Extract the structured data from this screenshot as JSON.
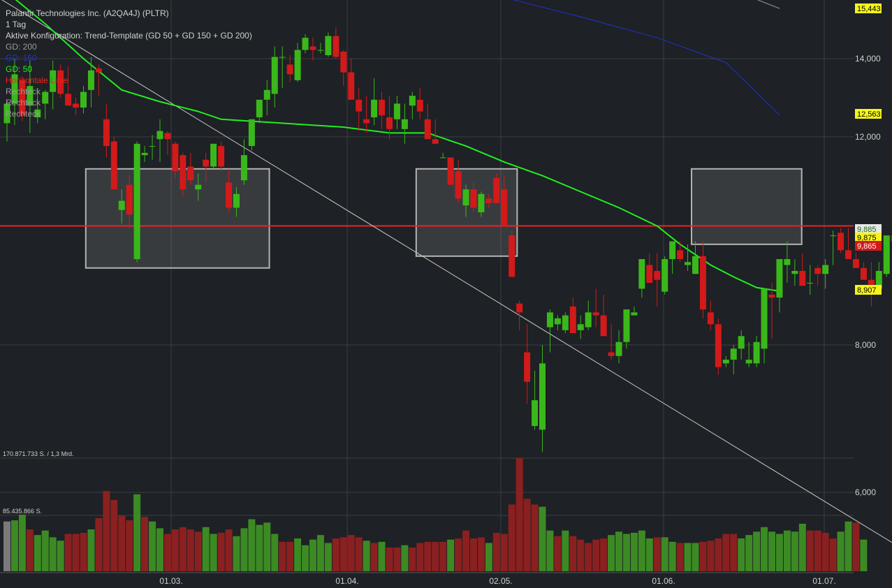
{
  "header": {
    "title": "Palantir Technologies Inc. (A2QA4J) (PLTR)",
    "interval": "1 Tag",
    "config": "Aktive Konfiguration: Trend-Template (GD 50 + GD 150 + GD 200)"
  },
  "legend": [
    {
      "label": "GD: 200",
      "color": "#9a9a9a"
    },
    {
      "label": "GD: 150",
      "color": "#2233cc"
    },
    {
      "label": "GD: 50",
      "color": "#22ee22"
    },
    {
      "label": "Horizontale Linie",
      "color": "#ee2222"
    },
    {
      "label": "Rechteck",
      "color": "#9a9a9a"
    },
    {
      "label": "Rechteck",
      "color": "#9a9a9a"
    },
    {
      "label": "Rechteck",
      "color": "#9a9a9a"
    }
  ],
  "volume_labels": {
    "max": "170.871.733 S. / 1,3 Mrd.",
    "mid": "85.435.866 S."
  },
  "colors": {
    "background": "#1e2125",
    "up": "#3ab81a",
    "down": "#d21a1a",
    "volume_up": "#3c8a24",
    "volume_down": "#8a2020",
    "grid": "#3a3e44",
    "sma50": "#22ee22",
    "sma150": "#2233cc",
    "sma200": "#9a9a9a",
    "hline": "#ee2222"
  },
  "chart_data": {
    "type": "candlestick",
    "y_ticks": [
      "6,000",
      "8,000",
      "12,000",
      "14,000"
    ],
    "x_ticks": [
      "01.03.",
      "01.04.",
      "02.05.",
      "01.06.",
      "01.07."
    ],
    "ylim": [
      5.4,
      15.7
    ],
    "price_labels": [
      {
        "text": "15,443",
        "value": 15.443,
        "style": "yellow"
      },
      {
        "text": "12,563",
        "value": 12.563,
        "style": "yellow"
      },
      {
        "text": "9,885",
        "value": 9.885,
        "style": "green"
      },
      {
        "text": "9,875",
        "value": 9.875,
        "style": "yellow"
      },
      {
        "text": "9,865",
        "value": 9.865,
        "style": "red"
      },
      {
        "text": "8,907",
        "value": 8.907,
        "style": "yellow"
      }
    ],
    "horizontal_line": 10.05,
    "series": [
      {
        "name": "GD 50",
        "values": [
          [
            0,
            15.9
          ],
          [
            5,
            15.0
          ],
          [
            10,
            14.0
          ],
          [
            15,
            13.2
          ],
          [
            20,
            12.9
          ],
          [
            25,
            12.65
          ],
          [
            28,
            12.45
          ],
          [
            32,
            12.4
          ],
          [
            36,
            12.35
          ],
          [
            40,
            12.3
          ],
          [
            44,
            12.25
          ],
          [
            50,
            12.1
          ],
          [
            55,
            12.1
          ],
          [
            60,
            11.8
          ],
          [
            65,
            11.45
          ],
          [
            70,
            11.15
          ],
          [
            75,
            10.8
          ],
          [
            80,
            10.45
          ],
          [
            85,
            10.05
          ],
          [
            88,
            9.7
          ],
          [
            92,
            9.35
          ],
          [
            95,
            9.15
          ],
          [
            98,
            8.97
          ],
          [
            101,
            8.91
          ]
        ]
      },
      {
        "name": "GD 150",
        "values": [
          [
            66,
            15.7
          ],
          [
            75,
            15.2
          ],
          [
            85,
            14.6
          ],
          [
            94,
            13.9
          ],
          [
            101,
            12.56
          ]
        ]
      },
      {
        "name": "GD 200",
        "values": [
          [
            98,
            15.7
          ],
          [
            101,
            15.44
          ]
        ]
      }
    ],
    "trendline": [
      [
        0,
        15.6
      ],
      [
        101,
        6.25
      ]
    ],
    "rectangles": [
      {
        "x0": 10.3,
        "x1": 34.3,
        "y0": 9.3,
        "y1": 11.3
      },
      {
        "x0": 53.5,
        "x1": 66.7,
        "y0": 9.5,
        "y1": 11.3
      },
      {
        "x0": 89.5,
        "x1": 103.9,
        "y0": 9.7,
        "y1": 11.3
      }
    ],
    "candles": [
      [
        12.35,
        12.95,
        11.9,
        12.85
      ],
      [
        12.85,
        14.0,
        12.3,
        13.6
      ],
      [
        13.45,
        13.55,
        12.4,
        12.55
      ],
      [
        12.8,
        13.95,
        12.1,
        13.3
      ],
      [
        12.5,
        13.25,
        12.35,
        12.7
      ],
      [
        12.85,
        13.2,
        12.45,
        13.15
      ],
      [
        13.15,
        13.95,
        12.7,
        13.7
      ],
      [
        13.7,
        13.85,
        13.0,
        13.1
      ],
      [
        13.1,
        13.8,
        12.95,
        12.8
      ],
      [
        12.85,
        13.0,
        12.55,
        12.75
      ],
      [
        12.75,
        13.3,
        12.6,
        13.15
      ],
      [
        13.2,
        14.05,
        12.75,
        13.7
      ],
      [
        13.75,
        13.85,
        13.05,
        13.65
      ],
      [
        12.45,
        12.85,
        11.55,
        11.8
      ],
      [
        11.9,
        12.0,
        10.85,
        10.85
      ],
      [
        10.4,
        10.85,
        10.1,
        10.6
      ],
      [
        10.95,
        11.15,
        10.0,
        10.3
      ],
      [
        9.45,
        11.9,
        9.4,
        11.85
      ],
      [
        11.6,
        11.8,
        11.45,
        11.65
      ],
      [
        11.8,
        12.05,
        11.5,
        11.8
      ],
      [
        11.95,
        12.45,
        11.45,
        12.15
      ],
      [
        12.1,
        12.15,
        11.6,
        11.95
      ],
      [
        11.85,
        11.9,
        11.1,
        11.25
      ],
      [
        11.6,
        11.65,
        10.7,
        10.85
      ],
      [
        11.35,
        11.65,
        10.95,
        11.05
      ],
      [
        10.85,
        11.2,
        10.6,
        10.95
      ],
      [
        11.5,
        11.65,
        11.0,
        11.35
      ],
      [
        11.35,
        11.8,
        11.3,
        11.85
      ],
      [
        11.8,
        11.9,
        11.25,
        11.35
      ],
      [
        11.0,
        11.3,
        10.35,
        10.45
      ],
      [
        10.45,
        10.9,
        10.25,
        10.75
      ],
      [
        11.05,
        11.95,
        10.95,
        11.6
      ],
      [
        11.8,
        12.4,
        11.7,
        12.45
      ],
      [
        12.5,
        12.85,
        12.35,
        12.95
      ],
      [
        12.95,
        13.45,
        12.55,
        13.2
      ],
      [
        13.1,
        14.35,
        12.75,
        14.05
      ],
      [
        14.05,
        14.35,
        13.25,
        14.05
      ],
      [
        13.85,
        14.1,
        13.4,
        13.6
      ],
      [
        13.45,
        14.45,
        13.4,
        14.25
      ],
      [
        14.25,
        14.7,
        14.15,
        14.6
      ],
      [
        14.35,
        14.6,
        13.95,
        14.25
      ],
      [
        14.25,
        14.45,
        14.15,
        14.25
      ],
      [
        14.1,
        14.75,
        14.05,
        14.65
      ],
      [
        14.65,
        14.9,
        14.0,
        14.05
      ],
      [
        14.2,
        14.25,
        13.3,
        13.65
      ],
      [
        13.65,
        14.0,
        12.95,
        12.95
      ],
      [
        12.95,
        13.25,
        12.15,
        12.65
      ],
      [
        12.45,
        13.05,
        12.1,
        12.35
      ],
      [
        12.5,
        13.5,
        12.3,
        12.95
      ],
      [
        12.95,
        13.15,
        12.2,
        12.55
      ],
      [
        12.5,
        13.05,
        11.95,
        12.2
      ],
      [
        12.45,
        13.05,
        12.2,
        12.85
      ],
      [
        12.2,
        12.85,
        11.85,
        12.45
      ],
      [
        12.8,
        13.15,
        12.45,
        13.05
      ],
      [
        12.95,
        13.25,
        12.45,
        12.65
      ],
      [
        12.45,
        12.85,
        12.05,
        11.95
      ],
      [
        11.95,
        12.45,
        11.85,
        11.85
      ],
      [
        11.55,
        11.65,
        11.55,
        11.55
      ],
      [
        11.55,
        11.55,
        11.1,
        10.95
      ],
      [
        11.25,
        11.5,
        10.55,
        10.65
      ],
      [
        10.5,
        10.95,
        10.25,
        10.85
      ],
      [
        10.85,
        11.0,
        10.35,
        10.45
      ],
      [
        10.35,
        10.8,
        10.25,
        10.75
      ],
      [
        10.65,
        10.75,
        10.45,
        10.55
      ],
      [
        11.1,
        11.2,
        10.55,
        10.55
      ],
      [
        10.85,
        11.15,
        10.35,
        10.05
      ],
      [
        9.85,
        9.95,
        9.15,
        9.15
      ],
      [
        8.7,
        8.75,
        8.25,
        8.55
      ],
      [
        7.9,
        8.35,
        7.2,
        7.5
      ],
      [
        6.9,
        7.65,
        6.85,
        7.25
      ],
      [
        6.85,
        8.0,
        6.55,
        7.75
      ],
      [
        8.3,
        8.6,
        7.9,
        8.55
      ],
      [
        8.35,
        8.5,
        8.25,
        8.45
      ],
      [
        8.25,
        8.55,
        8.2,
        8.5
      ],
      [
        8.65,
        8.8,
        8.25,
        8.2
      ],
      [
        8.25,
        8.5,
        8.1,
        8.35
      ],
      [
        8.3,
        8.75,
        8.25,
        8.55
      ],
      [
        8.55,
        8.95,
        8.3,
        8.5
      ],
      [
        8.5,
        8.85,
        8.15,
        8.15
      ],
      [
        7.9,
        8.35,
        7.8,
        7.85
      ],
      [
        7.85,
        8.25,
        7.75,
        8.05
      ],
      [
        8.05,
        8.6,
        7.95,
        8.6
      ],
      [
        8.5,
        8.65,
        8.5,
        8.55
      ],
      [
        8.95,
        9.35,
        8.8,
        9.45
      ],
      [
        9.35,
        9.55,
        9.1,
        9.05
      ],
      [
        9.25,
        9.55,
        8.65,
        9.1
      ],
      [
        8.9,
        9.5,
        8.85,
        9.45
      ],
      [
        9.45,
        9.55,
        9.2,
        9.75
      ],
      [
        9.6,
        9.75,
        9.4,
        9.45
      ],
      [
        9.35,
        9.7,
        9.25,
        9.4
      ],
      [
        9.2,
        9.75,
        9.2,
        9.5
      ],
      [
        9.5,
        9.75,
        8.45,
        8.6
      ],
      [
        8.55,
        8.75,
        8.25,
        8.35
      ],
      [
        8.35,
        8.45,
        7.6,
        7.7
      ],
      [
        7.75,
        7.85,
        7.7,
        7.8
      ],
      [
        7.8,
        8.0,
        7.6,
        7.95
      ],
      [
        7.95,
        8.25,
        7.8,
        8.15
      ],
      [
        7.75,
        8.05,
        7.7,
        7.8
      ],
      [
        7.75,
        8.15,
        7.7,
        8.05
      ],
      [
        7.95,
        8.95,
        7.75,
        8.95
      ],
      [
        8.85,
        9.05,
        8.1,
        8.8
      ],
      [
        8.8,
        9.1,
        8.55,
        9.45
      ],
      [
        9.35,
        9.75,
        9.05,
        9.45
      ],
      [
        9.2,
        9.45,
        9.0,
        9.25
      ],
      [
        9.25,
        9.55,
        9.15,
        9.0
      ],
      [
        9.05,
        9.35,
        8.85,
        9.05
      ],
      [
        9.3,
        9.35,
        9.0,
        9.2
      ],
      [
        9.2,
        9.45,
        8.95,
        9.35
      ],
      [
        9.85,
        9.95,
        9.35,
        9.85
      ],
      [
        9.9,
        10.0,
        9.55,
        9.6
      ],
      [
        9.6,
        10.0,
        9.45,
        9.45
      ],
      [
        9.45,
        9.55,
        9.35,
        9.3
      ],
      [
        9.3,
        9.4,
        9.2,
        9.1
      ],
      [
        9.1,
        9.4,
        8.65,
        9.0
      ],
      [
        8.95,
        9.4,
        8.85,
        9.25
      ],
      [
        9.2,
        9.8,
        9.15,
        9.85
      ],
      [
        9.85,
        10.15,
        9.75,
        9.75
      ],
      [
        9.75,
        10.0,
        9.7,
        9.95
      ],
      [
        9.95,
        10.1,
        9.8,
        9.85
      ]
    ],
    "volume": [
      [
        0.44,
        "flat"
      ],
      [
        0.45,
        "up"
      ],
      [
        0.5,
        "up"
      ],
      [
        0.37,
        "down"
      ],
      [
        0.32,
        "up"
      ],
      [
        0.36,
        "up"
      ],
      [
        0.3,
        "up"
      ],
      [
        0.27,
        "up"
      ],
      [
        0.33,
        "down"
      ],
      [
        0.33,
        "down"
      ],
      [
        0.34,
        "down"
      ],
      [
        0.37,
        "up"
      ],
      [
        0.47,
        "down"
      ],
      [
        0.71,
        "down"
      ],
      [
        0.63,
        "down"
      ],
      [
        0.49,
        "down"
      ],
      [
        0.45,
        "down"
      ],
      [
        0.68,
        "up"
      ],
      [
        0.48,
        "down"
      ],
      [
        0.44,
        "up"
      ],
      [
        0.38,
        "up"
      ],
      [
        0.33,
        "down"
      ],
      [
        0.37,
        "down"
      ],
      [
        0.39,
        "down"
      ],
      [
        0.37,
        "down"
      ],
      [
        0.35,
        "down"
      ],
      [
        0.39,
        "up"
      ],
      [
        0.33,
        "up"
      ],
      [
        0.34,
        "down"
      ],
      [
        0.37,
        "down"
      ],
      [
        0.31,
        "up"
      ],
      [
        0.38,
        "up"
      ],
      [
        0.46,
        "up"
      ],
      [
        0.41,
        "up"
      ],
      [
        0.43,
        "up"
      ],
      [
        0.33,
        "up"
      ],
      [
        0.26,
        "down"
      ],
      [
        0.26,
        "down"
      ],
      [
        0.29,
        "up"
      ],
      [
        0.23,
        "up"
      ],
      [
        0.28,
        "up"
      ],
      [
        0.32,
        "up"
      ],
      [
        0.25,
        "up"
      ],
      [
        0.29,
        "down"
      ],
      [
        0.3,
        "down"
      ],
      [
        0.32,
        "down"
      ],
      [
        0.3,
        "down"
      ],
      [
        0.27,
        "up"
      ],
      [
        0.25,
        "down"
      ],
      [
        0.26,
        "up"
      ],
      [
        0.21,
        "down"
      ],
      [
        0.21,
        "down"
      ],
      [
        0.23,
        "up"
      ],
      [
        0.21,
        "down"
      ],
      [
        0.25,
        "down"
      ],
      [
        0.26,
        "down"
      ],
      [
        0.26,
        "down"
      ],
      [
        0.26,
        "down"
      ],
      [
        0.28,
        "up"
      ],
      [
        0.29,
        "down"
      ],
      [
        0.36,
        "down"
      ],
      [
        0.29,
        "down"
      ],
      [
        0.3,
        "down"
      ],
      [
        0.25,
        "up"
      ],
      [
        0.34,
        "down"
      ],
      [
        0.33,
        "down"
      ],
      [
        0.59,
        "down"
      ],
      [
        1.0,
        "down"
      ],
      [
        0.64,
        "down"
      ],
      [
        0.59,
        "down"
      ],
      [
        0.57,
        "up"
      ],
      [
        0.36,
        "up"
      ],
      [
        0.31,
        "down"
      ],
      [
        0.36,
        "up"
      ],
      [
        0.31,
        "down"
      ],
      [
        0.28,
        "down"
      ],
      [
        0.25,
        "down"
      ],
      [
        0.28,
        "down"
      ],
      [
        0.29,
        "down"
      ],
      [
        0.32,
        "up"
      ],
      [
        0.35,
        "up"
      ],
      [
        0.33,
        "up"
      ],
      [
        0.34,
        "up"
      ],
      [
        0.36,
        "up"
      ],
      [
        0.29,
        "up"
      ],
      [
        0.3,
        "down"
      ],
      [
        0.3,
        "up"
      ],
      [
        0.26,
        "up"
      ],
      [
        0.25,
        "down"
      ],
      [
        0.25,
        "up"
      ],
      [
        0.25,
        "up"
      ],
      [
        0.26,
        "down"
      ],
      [
        0.27,
        "down"
      ],
      [
        0.29,
        "down"
      ],
      [
        0.33,
        "down"
      ],
      [
        0.33,
        "down"
      ],
      [
        0.29,
        "up"
      ],
      [
        0.32,
        "up"
      ],
      [
        0.35,
        "up"
      ],
      [
        0.39,
        "up"
      ],
      [
        0.35,
        "up"
      ],
      [
        0.33,
        "up"
      ],
      [
        0.36,
        "up"
      ],
      [
        0.35,
        "up"
      ],
      [
        0.42,
        "up"
      ],
      [
        0.36,
        "down"
      ],
      [
        0.36,
        "down"
      ],
      [
        0.34,
        "down"
      ],
      [
        0.29,
        "down"
      ],
      [
        0.35,
        "up"
      ],
      [
        0.44,
        "up"
      ],
      [
        0.43,
        "down"
      ],
      [
        0.28,
        "up"
      ]
    ]
  }
}
